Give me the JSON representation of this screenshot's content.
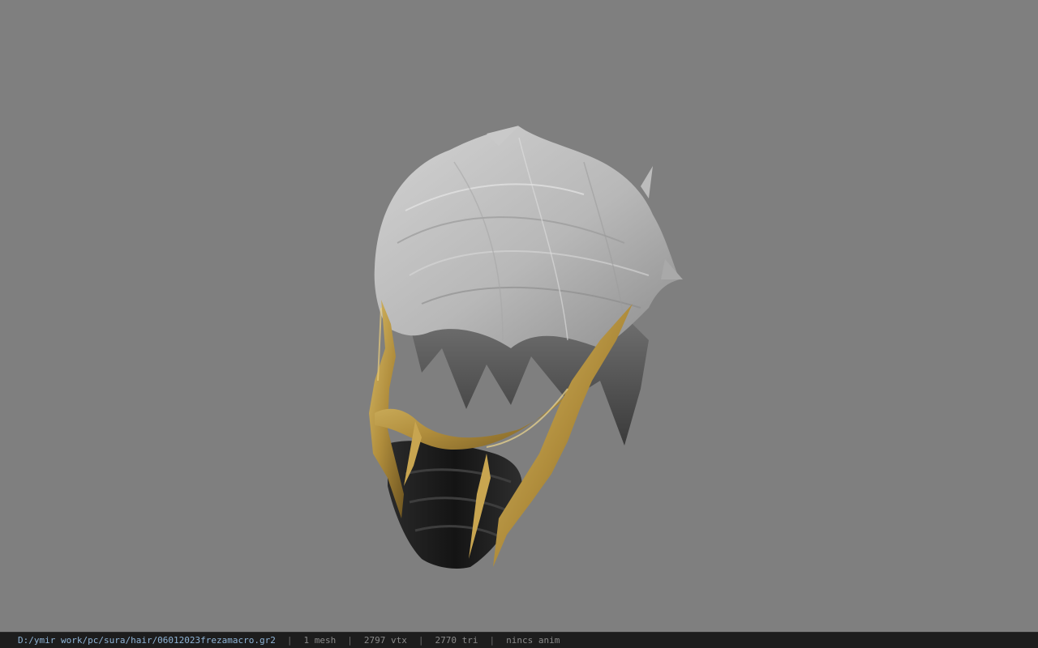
{
  "viewer": {
    "background_color": "#7f7f7f",
    "model": {
      "hair_icon": "hair-mesh",
      "mask_icon": "gold-face-mask",
      "hair_color": "#bdbdbd",
      "mask_gold_color": "#b08d3c",
      "mask_dark_color": "#1a1a1a"
    }
  },
  "statusbar": {
    "file_path": "D:/ymir work/pc/sura/hair/06012023frezamacro.gr2",
    "separator": "|",
    "mesh_count": "1 mesh",
    "vertex_count": "2797 vtx",
    "triangle_count": "2770 tri",
    "anim_status": "nincs anim"
  }
}
